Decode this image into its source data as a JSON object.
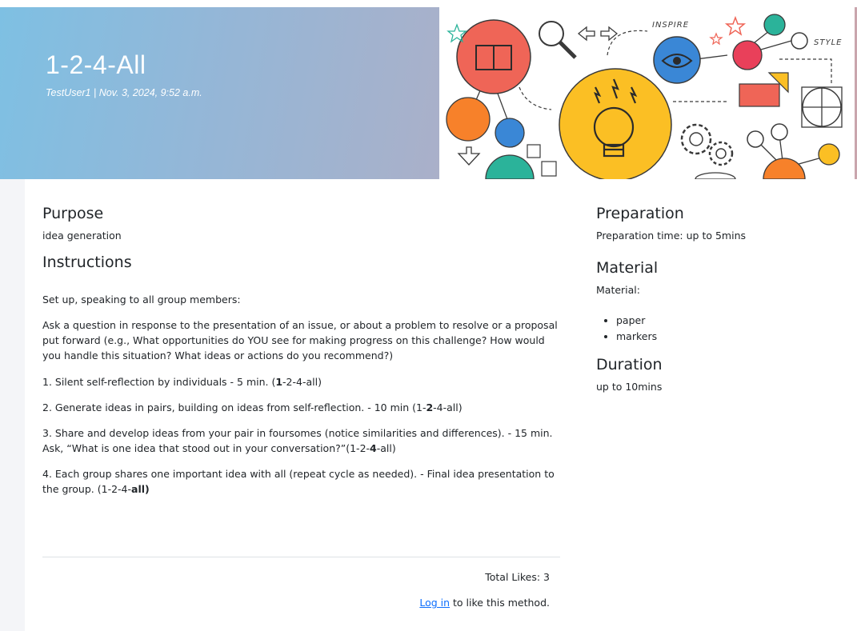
{
  "header": {
    "title": "1-2-4-All",
    "meta": "TestUser1 | Nov. 3, 2024, 9:52 a.m.",
    "illustration_words": [
      "INSPIRE",
      "STYLE"
    ]
  },
  "purpose": {
    "heading": "Purpose",
    "text": "idea generation"
  },
  "instructions": {
    "heading": "Instructions",
    "setup": "Set up, speaking to all group members:",
    "question": "Ask a question in response to the presentation of an issue, or about a problem to resolve or a proposal put forward (e.g., What opportunities do YOU see for making progress on this challenge? How would you handle this situation? What ideas or actions do you recommend?)",
    "steps": [
      {
        "text": "1. Silent self-reflection by individuals - 5 min. (",
        "bold": "1",
        "rest": "-2-4-all)"
      },
      {
        "text": "2. Generate ideas in pairs, building on ideas from self-reflection. - 10 min (1-",
        "bold": "2",
        "rest": "-4-all)"
      },
      {
        "text": "3. Share and develop ideas from your pair in foursomes (notice similarities and differences). - 15 min. Ask, “What is one idea that stood out in your conversation?”(1-2-",
        "bold": "4",
        "rest": "-all)"
      },
      {
        "text": "4. Each group shares one important idea with all (repeat cycle as needed). - Final idea presentation to the group. (1-2-4-",
        "bold": "all)",
        "rest": ""
      }
    ]
  },
  "preparation": {
    "heading": "Preparation",
    "text": "Preparation time: up to 5mins"
  },
  "material": {
    "heading": "Material",
    "label": "Material:",
    "items": [
      "paper",
      "markers"
    ]
  },
  "duration": {
    "heading": "Duration",
    "text": "up to 10mins"
  },
  "footer": {
    "likes": "Total Likes: 3",
    "login_link": "Log in",
    "login_suffix": " to like this method."
  },
  "colors": {
    "header_gradient_start": "#7ec0e3",
    "header_gradient_end": "#aab0c9",
    "link": "#0d6efd",
    "text": "#212529"
  }
}
